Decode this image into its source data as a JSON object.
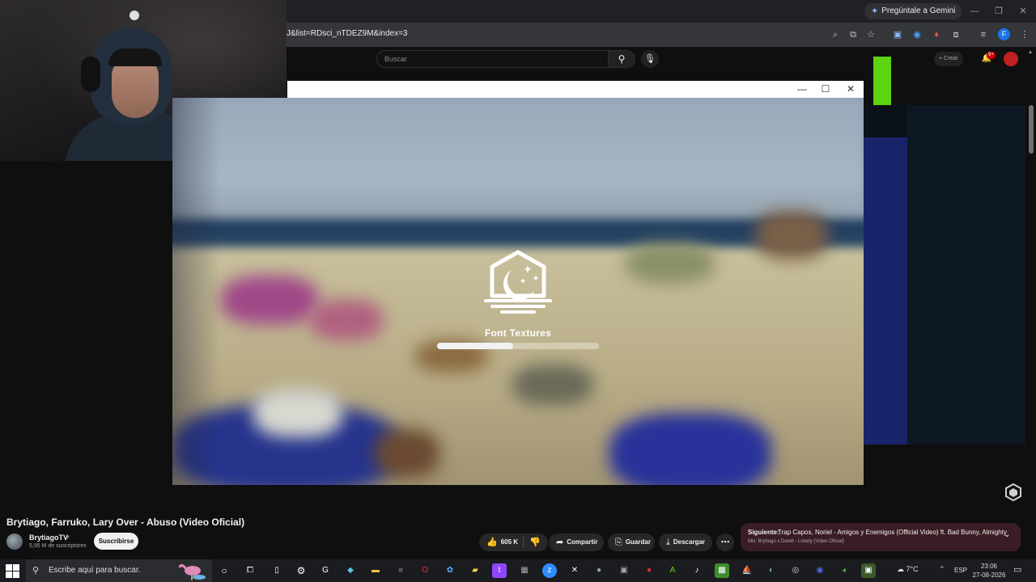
{
  "browser": {
    "url": "J&list=RDsci_nTDEZ9M&index=3",
    "gemini_button": "Pregúntale a Gemini",
    "profile_initial": "F"
  },
  "youtube_header": {
    "search_placeholder": "Buscar",
    "create_label": "+ Crear",
    "notifications_badge": "9+"
  },
  "game_launcher": {
    "loading_title": "Font Textures",
    "progress": 0.47
  },
  "video": {
    "title": "Brytiago, Farruko, Lary Over - Abuso (Video Oficial)",
    "channel": "BrytiagoTV",
    "subscribers": "5,95 M de suscriptores",
    "subscribe_label": "Suscribirse",
    "likes": "605 K",
    "share_label": "Compartir",
    "save_label": "Guardar",
    "download_label": "Descargar"
  },
  "up_next": {
    "label": "Siguiente:",
    "title": "Trap Capos, Noriel - Amigos y Enemigos (Official Video) ft. Bad Bunny, Almighty",
    "mix": "Mix: Brytiago x Darell - Lonely (Video Oficial)"
  },
  "taskbar": {
    "search_placeholder": "Escribe aquí para buscar.",
    "weather": "7°C",
    "language": "ESP",
    "time": "23:06",
    "date": "27-08-2026"
  },
  "colors": {
    "accent_green": "#5cd40f",
    "next_card_bg": "#3a1d24"
  }
}
